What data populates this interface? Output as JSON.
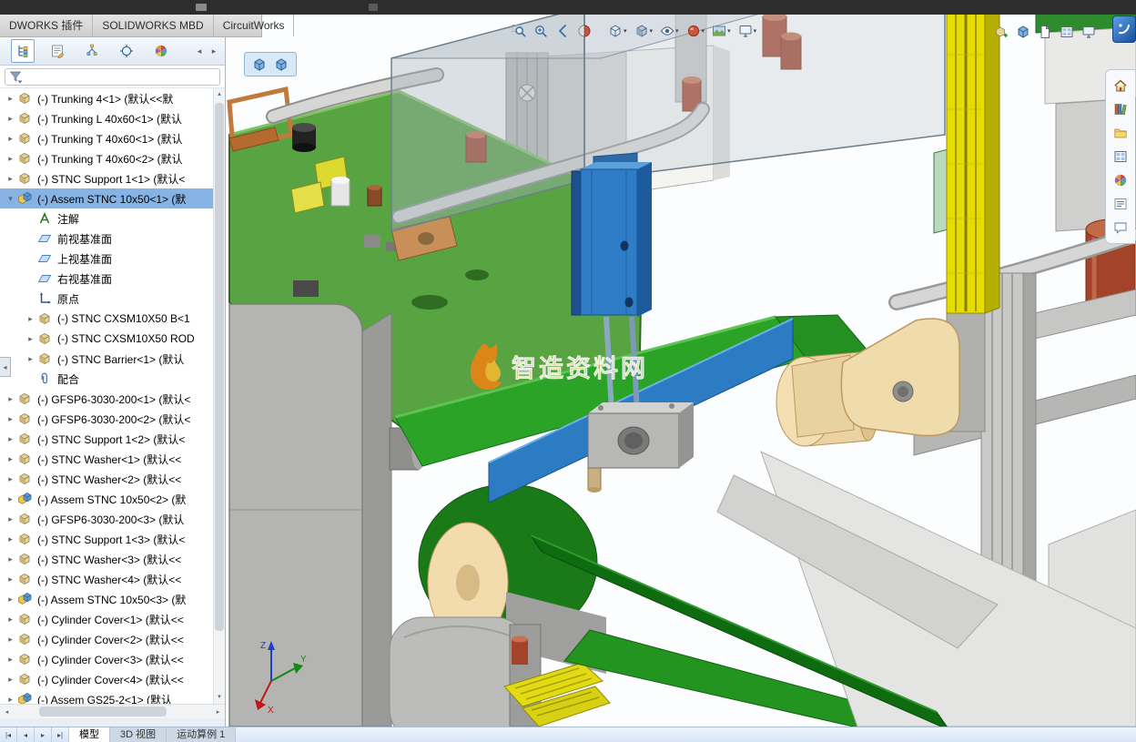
{
  "colors": {
    "selection_blue": "#86b3e3",
    "watermark_orange": "#f29021",
    "belt_green": "#2ba327",
    "cylinder_blue": "#2f7cc7",
    "extrusion_yellow": "#e6dc00",
    "roller_tan": "#f2dcae"
  },
  "ribbon": {
    "tabs": [
      "DWORKS 插件",
      "SOLIDWORKS MBD",
      "CircuitWorks"
    ]
  },
  "left_panel": {
    "tabs": [
      {
        "name": "featuremanager-tree",
        "icon": "feature-tree",
        "active": true
      },
      {
        "name": "property-manager",
        "icon": "property-manager",
        "active": false
      },
      {
        "name": "configuration-manager",
        "icon": "configuration-manager",
        "active": false
      },
      {
        "name": "dimxpert-manager",
        "icon": "dimxpert",
        "active": false
      },
      {
        "name": "display-manager",
        "icon": "display-manager",
        "active": false
      }
    ],
    "scroll_buttons": [
      {
        "name": "panel-tabs-scroll-left",
        "glyph": "◂"
      },
      {
        "name": "panel-tabs-scroll-right",
        "glyph": "▸"
      }
    ],
    "collapse_button_glyph": "◂",
    "filter": {
      "icon": "funnel"
    },
    "tree_items": [
      {
        "level": 0,
        "expand": "collapsed",
        "icon": "part",
        "label": "(-) Trunking 4<1> (默认<<默"
      },
      {
        "level": 0,
        "expand": "collapsed",
        "icon": "part",
        "label": "(-) Trunking L 40x60<1> (默认"
      },
      {
        "level": 0,
        "expand": "collapsed",
        "icon": "part",
        "label": "(-) Trunking T 40x60<1> (默认"
      },
      {
        "level": 0,
        "expand": "collapsed",
        "icon": "part",
        "label": "(-) Trunking T 40x60<2> (默认"
      },
      {
        "level": 0,
        "expand": "collapsed",
        "icon": "part",
        "label": "(-) STNC Support 1<1> (默认<"
      },
      {
        "level": 0,
        "expand": "expanded",
        "icon": "assembly",
        "label": "(-) Assem STNC 10x50<1> (默",
        "selected": true
      },
      {
        "level": 1,
        "expand": null,
        "icon": "annotations",
        "label": "注解"
      },
      {
        "level": 1,
        "expand": null,
        "icon": "plane",
        "label": "前视基准面"
      },
      {
        "level": 1,
        "expand": null,
        "icon": "plane",
        "label": "上视基准面"
      },
      {
        "level": 1,
        "expand": null,
        "icon": "plane",
        "label": "右视基准面"
      },
      {
        "level": 1,
        "expand": null,
        "icon": "origin",
        "label": "原点"
      },
      {
        "level": 1,
        "expand": "collapsed",
        "icon": "part",
        "label": "(-) STNC CXSM10X50 B<1"
      },
      {
        "level": 1,
        "expand": "collapsed",
        "icon": "part",
        "label": "(-) STNC CXSM10X50 ROD"
      },
      {
        "level": 1,
        "expand": "collapsed",
        "icon": "part",
        "label": "(-) STNC Barrier<1> (默认"
      },
      {
        "level": 1,
        "expand": null,
        "icon": "mates",
        "label": "配合"
      },
      {
        "level": 0,
        "expand": "collapsed",
        "icon": "part",
        "label": "(-) GFSP6-3030-200<1> (默认<"
      },
      {
        "level": 0,
        "expand": "collapsed",
        "icon": "part",
        "label": "(-) GFSP6-3030-200<2> (默认<"
      },
      {
        "level": 0,
        "expand": "collapsed",
        "icon": "part",
        "label": "(-) STNC Support 1<2> (默认<"
      },
      {
        "level": 0,
        "expand": "collapsed",
        "icon": "part",
        "label": "(-) STNC Washer<1> (默认<<"
      },
      {
        "level": 0,
        "expand": "collapsed",
        "icon": "part",
        "label": "(-) STNC Washer<2> (默认<<"
      },
      {
        "level": 0,
        "expand": "collapsed",
        "icon": "assembly",
        "label": "(-) Assem STNC 10x50<2> (默"
      },
      {
        "level": 0,
        "expand": "collapsed",
        "icon": "part",
        "label": "(-) GFSP6-3030-200<3> (默认"
      },
      {
        "level": 0,
        "expand": "collapsed",
        "icon": "part",
        "label": "(-) STNC Support 1<3> (默认<"
      },
      {
        "level": 0,
        "expand": "collapsed",
        "icon": "part",
        "label": "(-) STNC Washer<3> (默认<<"
      },
      {
        "level": 0,
        "expand": "collapsed",
        "icon": "part",
        "label": "(-) STNC Washer<4> (默认<<"
      },
      {
        "level": 0,
        "expand": "collapsed",
        "icon": "assembly",
        "label": "(-) Assem STNC 10x50<3> (默"
      },
      {
        "level": 0,
        "expand": "collapsed",
        "icon": "part",
        "label": "(-) Cylinder Cover<1> (默认<<"
      },
      {
        "level": 0,
        "expand": "collapsed",
        "icon": "part",
        "label": "(-) Cylinder Cover<2> (默认<<"
      },
      {
        "level": 0,
        "expand": "collapsed",
        "icon": "part",
        "label": "(-) Cylinder Cover<3> (默认<<"
      },
      {
        "level": 0,
        "expand": "collapsed",
        "icon": "part",
        "label": "(-) Cylinder Cover<4> (默认<<"
      },
      {
        "level": 0,
        "expand": "collapsed",
        "icon": "assembly",
        "label": "(-) Assem GS25-2<1> (默认"
      }
    ]
  },
  "viewport": {
    "context_toolbar": [
      {
        "name": "select-subassembly",
        "icon": "assembly-cube"
      },
      {
        "name": "open-subassembly",
        "icon": "assembly-cube"
      }
    ],
    "heads_up_toolbar": [
      {
        "name": "zoom-to-fit",
        "icon": "zoom-fit"
      },
      {
        "name": "zoom-to-area",
        "icon": "zoom-area"
      },
      {
        "name": "previous-view",
        "icon": "previous-view"
      },
      {
        "name": "section-view",
        "icon": "section-view"
      },
      {
        "name": "view-orientation",
        "icon": "view-orientation",
        "caret": true
      },
      {
        "name": "display-style",
        "icon": "display-style",
        "caret": true
      },
      {
        "name": "hide-show-items",
        "icon": "hide-show-items",
        "caret": true
      },
      {
        "name": "edit-appearance",
        "icon": "edit-appearance",
        "caret": true
      },
      {
        "name": "apply-scene",
        "icon": "apply-scene",
        "caret": true
      },
      {
        "name": "view-settings",
        "icon": "view-settings",
        "caret": true
      }
    ],
    "top_right_toolbar": [
      {
        "name": "insert-component",
        "icon": "insert-component"
      },
      {
        "name": "component-preview",
        "icon": "assembly-cube"
      },
      {
        "name": "new-sheet",
        "icon": "page"
      },
      {
        "name": "view-palette-tool",
        "icon": "view-palette"
      },
      {
        "name": "screen-capture",
        "icon": "view-settings"
      }
    ],
    "logo_button": {
      "name": "solidworks-logo",
      "icon": "sw-logo"
    },
    "task_pane": [
      {
        "name": "solidworks-resources",
        "icon": "home"
      },
      {
        "name": "design-library",
        "icon": "design-library"
      },
      {
        "name": "file-explorer",
        "icon": "file-explorer"
      },
      {
        "name": "view-palette",
        "icon": "view-palette"
      },
      {
        "name": "appearances-scenes",
        "icon": "appearances"
      },
      {
        "name": "custom-properties",
        "icon": "custom-properties"
      },
      {
        "name": "solidworks-forum",
        "icon": "forum"
      }
    ],
    "watermark": {
      "text": "智造资料网",
      "color": "#f29021"
    },
    "triad": {
      "x": "X",
      "y": "Y",
      "z": "Z"
    }
  },
  "status_bar": {
    "scroll_buttons": [
      {
        "name": "doc-tab-scroll-first",
        "glyph": "|◂"
      },
      {
        "name": "doc-tab-scroll-prev",
        "glyph": "◂"
      },
      {
        "name": "doc-tab-scroll-next",
        "glyph": "▸"
      },
      {
        "name": "doc-tab-scroll-last",
        "glyph": "▸|"
      }
    ],
    "tabs": [
      {
        "label": "模型",
        "active": true
      },
      {
        "label": "3D 视图",
        "active": false
      },
      {
        "label": "运动算例 1",
        "active": false
      }
    ]
  }
}
